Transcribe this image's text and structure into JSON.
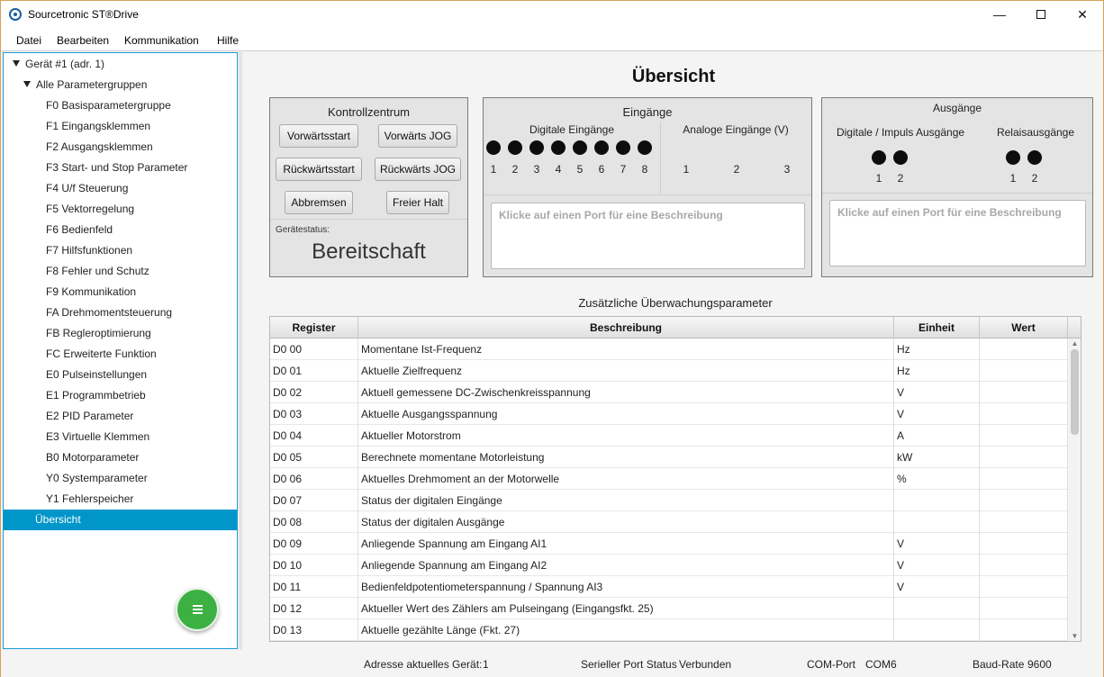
{
  "window": {
    "title": "Sourcetronic ST®Drive",
    "minimize": "—",
    "close": "✕"
  },
  "menu": [
    "Datei",
    "Bearbeiten",
    "Kommunikation",
    "Hilfe"
  ],
  "sidebar": {
    "device": "Gerät #1 (adr. 1)",
    "group": "Alle Parametergruppen",
    "items": [
      "F0 Basisparametergruppe",
      "F1 Eingangsklemmen",
      "F2 Ausgangsklemmen",
      "F3 Start- und Stop Parameter",
      "F4 U/f Steuerung",
      "F5 Vektorregelung",
      "F6 Bedienfeld",
      "F7 Hilfsfunktionen",
      "F8 Fehler und Schutz",
      "F9 Kommunikation",
      "FA Drehmomentsteuerung",
      "FB Regleroptimierung",
      "FC Erweiterte Funktion",
      "E0 Pulseinstellungen",
      "E1 Programmbetrieb",
      "E2 PID Parameter",
      "E3 Virtuelle Klemmen",
      "B0 Motorparameter",
      "Y0 Systemparameter",
      "Y1 Fehlerspeicher"
    ],
    "selected": "Übersicht",
    "fab_icon": "menu-icon"
  },
  "main": {
    "title": "Übersicht",
    "control": {
      "title": "Kontrollzentrum",
      "buttons": {
        "forward_start": "Vorwärtsstart",
        "forward_jog": "Vorwärts JOG",
        "reverse_start": "Rückwärtsstart",
        "reverse_jog": "Rückwärts JOG",
        "brake": "Abbremsen",
        "free_stop": "Freier Halt"
      },
      "status_label": "Gerätestatus:",
      "status_value": "Bereitschaft"
    },
    "inputs": {
      "title": "Eingänge",
      "digital_label": "Digitale Eingänge",
      "digital_ports": [
        "1",
        "2",
        "3",
        "4",
        "5",
        "6",
        "7",
        "8"
      ],
      "analog_label": "Analoge Eingänge (V)",
      "analog_ports": [
        "1",
        "2",
        "3"
      ],
      "description_placeholder": "Klicke auf einen Port für eine Beschreibung"
    },
    "outputs": {
      "title": "Ausgänge",
      "digital_label": "Digitale / Impuls Ausgänge",
      "digital_ports": [
        "1",
        "2"
      ],
      "relay_label": "Relaisausgänge",
      "relay_ports": [
        "1",
        "2"
      ],
      "description_placeholder": "Klicke auf einen Port für eine Beschreibung"
    },
    "monitor": {
      "title": "Zusätzliche Überwachungsparameter",
      "columns": [
        "Register",
        "Beschreibung",
        "Einheit",
        "Wert"
      ],
      "rows": [
        {
          "register": "D0 00",
          "description": "Momentane Ist-Frequenz",
          "unit": "Hz",
          "value": ""
        },
        {
          "register": "D0 01",
          "description": "Aktuelle Zielfrequenz",
          "unit": "Hz",
          "value": ""
        },
        {
          "register": "D0 02",
          "description": "Aktuell gemessene DC-Zwischenkreisspannung",
          "unit": "V",
          "value": ""
        },
        {
          "register": "D0 03",
          "description": "Aktuelle Ausgangsspannung",
          "unit": "V",
          "value": ""
        },
        {
          "register": "D0 04",
          "description": "Aktueller Motorstrom",
          "unit": "A",
          "value": ""
        },
        {
          "register": "D0 05",
          "description": "Berechnete momentane Motorleistung",
          "unit": "kW",
          "value": ""
        },
        {
          "register": "D0 06",
          "description": "Aktuelles Drehmoment an der Motorwelle",
          "unit": "%",
          "value": ""
        },
        {
          "register": "D0 07",
          "description": "Status der digitalen Eingänge",
          "unit": "",
          "value": ""
        },
        {
          "register": "D0 08",
          "description": "Status der digitalen Ausgänge",
          "unit": "",
          "value": ""
        },
        {
          "register": "D0 09",
          "description": "Anliegende Spannung am Eingang AI1",
          "unit": "V",
          "value": ""
        },
        {
          "register": "D0 10",
          "description": "Anliegende Spannung am Eingang AI2",
          "unit": "V",
          "value": ""
        },
        {
          "register": "D0 11",
          "description": "Bedienfeldpotentiometerspannung / Spannung AI3",
          "unit": "V",
          "value": ""
        },
        {
          "register": "D0 12",
          "description": "Aktueller Wert des Zählers am Pulseingang (Eingangsfkt. 25)",
          "unit": "",
          "value": ""
        },
        {
          "register": "D0 13",
          "description": "Aktuelle gezählte Länge (Fkt. 27)",
          "unit": "",
          "value": ""
        }
      ]
    }
  },
  "status": {
    "address_label": "Adresse aktuelles Gerät:",
    "address_value": "1",
    "serial_label": "Serieller Port Status",
    "serial_value": "Verbunden",
    "com_label": "COM-Port",
    "com_value": "COM6",
    "baud_label": "Baud-Rate",
    "baud_value": "9600"
  }
}
